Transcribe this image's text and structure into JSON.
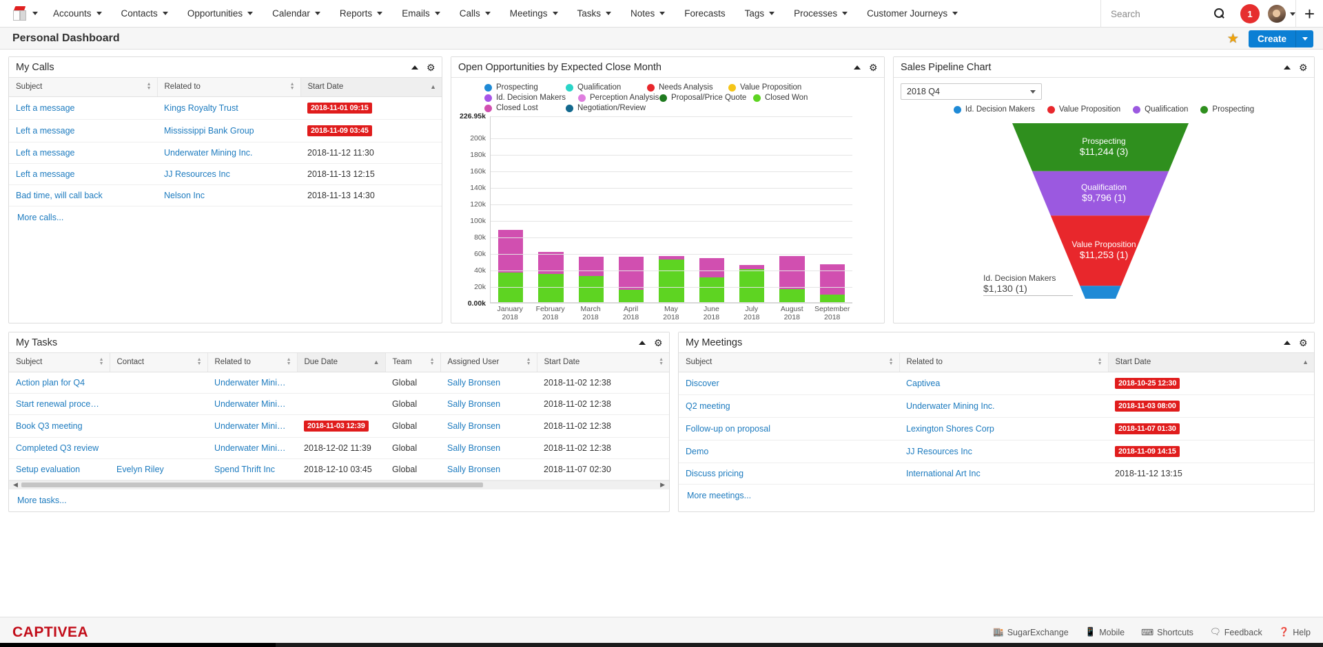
{
  "nav": {
    "logo_icon": "sugar-cube-logo",
    "items": [
      {
        "label": "Accounts",
        "caret": true
      },
      {
        "label": "Contacts",
        "caret": true
      },
      {
        "label": "Opportunities",
        "caret": true
      },
      {
        "label": "Calendar",
        "caret": true
      },
      {
        "label": "Reports",
        "caret": true
      },
      {
        "label": "Emails",
        "caret": true
      },
      {
        "label": "Calls",
        "caret": true
      },
      {
        "label": "Meetings",
        "caret": true
      },
      {
        "label": "Tasks",
        "caret": true
      },
      {
        "label": "Notes",
        "caret": true
      },
      {
        "label": "Forecasts",
        "caret": false
      },
      {
        "label": "Tags",
        "caret": true
      },
      {
        "label": "Processes",
        "caret": true
      },
      {
        "label": "Customer Journeys",
        "caret": true
      }
    ],
    "search_placeholder": "Search",
    "search_value": "",
    "notification_count": "1",
    "plus_label": "+"
  },
  "titlebar": {
    "title": "Personal Dashboard",
    "favorite_icon": "star-icon",
    "create_label": "Create"
  },
  "my_calls": {
    "title": "My Calls",
    "columns": [
      "Subject",
      "Related to",
      "Start Date"
    ],
    "sorted_column": "Start Date",
    "rows": [
      {
        "subject": "Left a message",
        "related": "Kings Royalty Trust",
        "start": "2018-11-01 09:15",
        "overdue": true
      },
      {
        "subject": "Left a message",
        "related": "Mississippi Bank Group",
        "start": "2018-11-09 03:45",
        "overdue": true
      },
      {
        "subject": "Left a message",
        "related": "Underwater Mining Inc.",
        "start": "2018-11-12 11:30",
        "overdue": false
      },
      {
        "subject": "Left a message",
        "related": "JJ Resources Inc",
        "start": "2018-11-13 12:15",
        "overdue": false
      },
      {
        "subject": "Bad time, will call back",
        "related": "Nelson Inc",
        "start": "2018-11-13 14:30",
        "overdue": false
      }
    ],
    "more_label": "More calls..."
  },
  "opportunities_panel": {
    "title": "Open Opportunities by Expected Close Month"
  },
  "pipeline_panel": {
    "title": "Sales Pipeline Chart",
    "period_selected": "2018 Q4"
  },
  "my_tasks": {
    "title": "My Tasks",
    "columns": [
      "Subject",
      "Contact",
      "Related to",
      "Due Date",
      "Team",
      "Assigned User",
      "Start Date"
    ],
    "sorted_column": "Due Date",
    "rows": [
      {
        "subject": "Action plan for Q4",
        "contact": "",
        "related": "Underwater Mining I...",
        "due": "",
        "due_overdue": false,
        "team": "Global",
        "user": "Sally Bronsen",
        "start": "2018-11-02 12:38"
      },
      {
        "subject": "Start renewal proces o...",
        "contact": "",
        "related": "Underwater Mining I...",
        "due": "",
        "due_overdue": false,
        "team": "Global",
        "user": "Sally Bronsen",
        "start": "2018-11-02 12:38"
      },
      {
        "subject": "Book Q3 meeting",
        "contact": "",
        "related": "Underwater Mining I...",
        "due": "2018-11-03 12:39",
        "due_overdue": true,
        "team": "Global",
        "user": "Sally Bronsen",
        "start": "2018-11-02 12:38"
      },
      {
        "subject": "Completed Q3 review",
        "contact": "",
        "related": "Underwater Mining I...",
        "due": "2018-12-02 11:39",
        "due_overdue": false,
        "team": "Global",
        "user": "Sally Bronsen",
        "start": "2018-11-02 12:38"
      },
      {
        "subject": "Setup evaluation",
        "contact": "Evelyn Riley",
        "related": "Spend Thrift Inc",
        "due": "2018-12-10 03:45",
        "due_overdue": false,
        "team": "Global",
        "user": "Sally Bronsen",
        "start": "2018-11-07 02:30"
      }
    ],
    "more_label": "More tasks..."
  },
  "my_meetings": {
    "title": "My Meetings",
    "columns": [
      "Subject",
      "Related to",
      "Start Date"
    ],
    "sorted_column": "Start Date",
    "rows": [
      {
        "subject": "Discover",
        "related": "Captivea",
        "start": "2018-10-25 12:30",
        "overdue": true
      },
      {
        "subject": "Q2 meeting",
        "related": "Underwater Mining Inc.",
        "start": "2018-11-03 08:00",
        "overdue": true
      },
      {
        "subject": "Follow-up on proposal",
        "related": "Lexington Shores Corp",
        "start": "2018-11-07 01:30",
        "overdue": true
      },
      {
        "subject": "Demo",
        "related": "JJ Resources Inc",
        "start": "2018-11-09 14:15",
        "overdue": true
      },
      {
        "subject": "Discuss pricing",
        "related": "International Art Inc",
        "start": "2018-11-12 13:15",
        "overdue": false
      }
    ],
    "more_label": "More meetings..."
  },
  "footer": {
    "brand": "CAPTIVEA",
    "links": [
      {
        "label": "SugarExchange",
        "icon": "store-icon"
      },
      {
        "label": "Mobile",
        "icon": "mobile-icon"
      },
      {
        "label": "Shortcuts",
        "icon": "keyboard-icon"
      },
      {
        "label": "Feedback",
        "icon": "speech-bubble-icon"
      },
      {
        "label": "Help",
        "icon": "question-circle-icon"
      }
    ]
  },
  "chart_data": [
    {
      "type": "bar",
      "title": "Open Opportunities by Expected Close Month",
      "stacked": true,
      "xlabel": "",
      "ylabel": "",
      "ylim": [
        0,
        226950
      ],
      "ytick_labels": [
        "0.00k",
        "20k",
        "40k",
        "60k",
        "80k",
        "100k",
        "120k",
        "140k",
        "160k",
        "180k",
        "200k",
        "226.95k"
      ],
      "ytick_values": [
        0,
        20000,
        40000,
        60000,
        80000,
        100000,
        120000,
        140000,
        160000,
        180000,
        200000,
        226950
      ],
      "grid": true,
      "legend_position": "top",
      "legend": [
        {
          "label": "Prospecting",
          "color": "#1f8ad6"
        },
        {
          "label": "Qualification",
          "color": "#2ad5c8"
        },
        {
          "label": "Needs Analysis",
          "color": "#e8272c"
        },
        {
          "label": "Value Proposition",
          "color": "#f5c518"
        },
        {
          "label": "Id. Decision Makers",
          "color": "#a855e8"
        },
        {
          "label": "Perception Analysis",
          "color": "#df7edf"
        },
        {
          "label": "Proposal/Price Quote",
          "color": "#1f7a1f"
        },
        {
          "label": "Closed Won",
          "color": "#5ed422"
        },
        {
          "label": "Closed Lost",
          "color": "#d14fb0"
        },
        {
          "label": "Negotiation/Review",
          "color": "#13698e"
        }
      ],
      "categories": [
        "January 2018",
        "February 2018",
        "March 2018",
        "April 2018",
        "May 2018",
        "June 2018",
        "July 2018",
        "August 2018",
        "September 2018"
      ],
      "series": [
        {
          "name": "Closed Won",
          "color": "#5ed422",
          "values": [
            36000,
            34000,
            32000,
            15000,
            52000,
            30000,
            40000,
            16000,
            9000
          ]
        },
        {
          "name": "Closed Lost",
          "color": "#d14fb0",
          "values": [
            52000,
            27000,
            23000,
            40000,
            4000,
            23000,
            5000,
            40000,
            37000
          ]
        }
      ]
    },
    {
      "type": "funnel",
      "title": "Sales Pipeline Chart",
      "period": "2018 Q4",
      "legend": [
        {
          "label": "Id. Decision Makers",
          "color": "#1f8ad6"
        },
        {
          "label": "Value Proposition",
          "color": "#e8272c"
        },
        {
          "label": "Qualification",
          "color": "#9b59e0"
        },
        {
          "label": "Prospecting",
          "color": "#2f8f1e"
        }
      ],
      "stages": [
        {
          "label": "Prospecting",
          "amount": "$11,244",
          "count": "(3)",
          "value": 11244,
          "color": "#2f8f1e",
          "inside": true
        },
        {
          "label": "Qualification",
          "amount": "$9,796",
          "count": "(1)",
          "value": 9796,
          "color": "#9b59e0",
          "inside": true
        },
        {
          "label": "Value Proposition",
          "amount": "$11,253",
          "count": "(1)",
          "value": 11253,
          "color": "#e8272c",
          "inside": true
        },
        {
          "label": "Id. Decision Makers",
          "amount": "$1,130",
          "count": "(1)",
          "value": 1130,
          "color": "#1f8ad6",
          "inside": false
        }
      ]
    }
  ]
}
